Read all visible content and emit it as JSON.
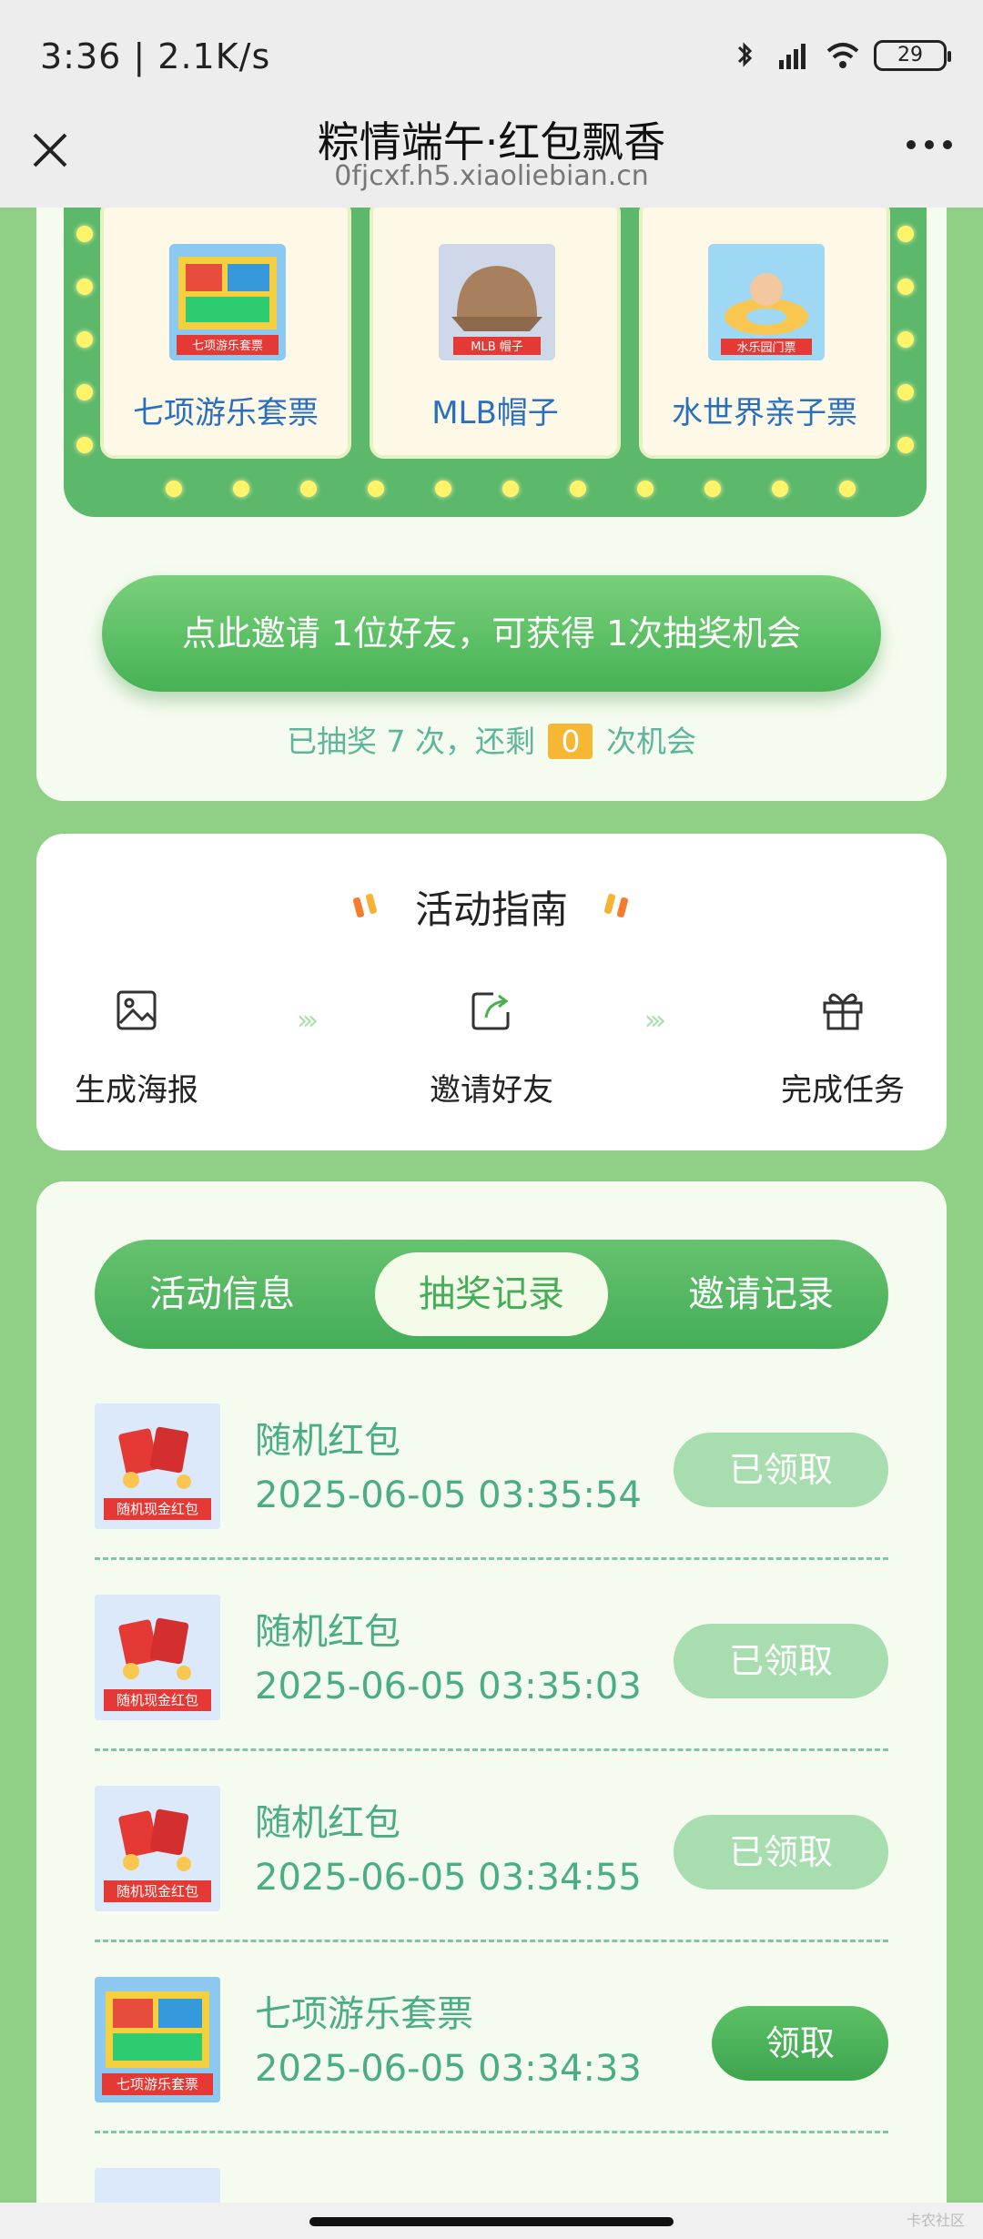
{
  "status": {
    "time_speed": "3:36 | 2.1K/s",
    "battery": "29"
  },
  "nav": {
    "title": "粽情端午·红包飘香",
    "url": "0fjcxf.h5.xiaoliebian.cn"
  },
  "prizes": [
    {
      "name": "七项游乐套票",
      "img_label": "七项游乐套票"
    },
    {
      "name": "MLB帽子",
      "img_label": "MLB 帽子"
    },
    {
      "name": "水世界亲子票",
      "img_label": "水乐园门票"
    }
  ],
  "invite": {
    "button_label": "点此邀请 1位好友，可获得 1次抽奖机会",
    "drawn_prefix": "已抽奖 7 次，还剩",
    "remaining": "0",
    "remaining_suffix": "次机会"
  },
  "guide": {
    "title": "活动指南",
    "steps": [
      {
        "label": "生成海报",
        "icon": "poster-icon"
      },
      {
        "label": "邀请好友",
        "icon": "share-icon"
      },
      {
        "label": "完成任务",
        "icon": "gift-icon"
      }
    ],
    "arrow": "›››"
  },
  "tabs": [
    "活动信息",
    "抽奖记录",
    "邀请记录"
  ],
  "records": [
    {
      "name": "随机红包",
      "time": "2025-06-05 03:35:54",
      "button": "已领取",
      "img_label": "随机现金红包"
    },
    {
      "name": "随机红包",
      "time": "2025-06-05 03:35:03",
      "button": "已领取",
      "img_label": "随机现金红包"
    },
    {
      "name": "随机红包",
      "time": "2025-06-05 03:34:55",
      "button": "已领取",
      "img_label": "随机现金红包"
    },
    {
      "name": "七项游乐套票",
      "time": "2025-06-05 03:34:33",
      "button": "领取",
      "img_label": "七项游乐套票"
    }
  ],
  "watermark": "卡农社区",
  "colors": {
    "bg_green": "#8fcf86",
    "accent_green": "#45ad58",
    "text_teal": "#4aae82",
    "badge_yellow": "#f6b735"
  }
}
